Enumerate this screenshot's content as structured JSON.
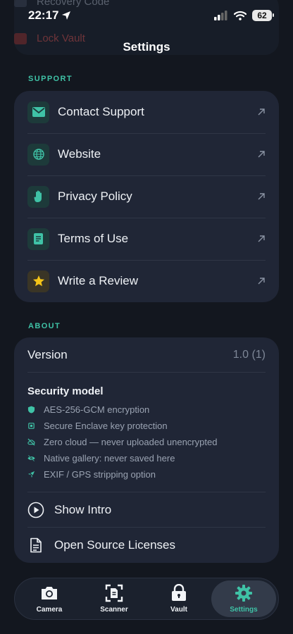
{
  "status_bar": {
    "time": "22:17",
    "battery": "62"
  },
  "background_rows": [
    {
      "label": "Recovery Code"
    },
    {
      "label": "Lock Vault"
    }
  ],
  "nav": {
    "title": "Settings"
  },
  "support": {
    "heading": "SUPPORT",
    "items": [
      {
        "label": "Contact Support",
        "icon": "envelope-icon"
      },
      {
        "label": "Website",
        "icon": "globe-icon"
      },
      {
        "label": "Privacy Policy",
        "icon": "hand-icon"
      },
      {
        "label": "Terms of Use",
        "icon": "document-icon"
      },
      {
        "label": "Write a Review",
        "icon": "star-icon"
      }
    ]
  },
  "about": {
    "heading": "ABOUT",
    "version_label": "Version",
    "version_value": "1.0 (1)",
    "security_title": "Security model",
    "security_items": [
      {
        "text": "AES-256-GCM encryption",
        "icon": "shield-icon"
      },
      {
        "text": "Secure Enclave key protection",
        "icon": "chip-icon"
      },
      {
        "text": "Zero cloud — never uploaded unencrypted",
        "icon": "cloud-off-icon"
      },
      {
        "text": "Native gallery: never saved here",
        "icon": "eye-off-icon"
      },
      {
        "text": "EXIF / GPS stripping option",
        "icon": "location-off-icon"
      }
    ],
    "show_intro": "Show Intro",
    "licenses": "Open Source Licenses"
  },
  "tabs": [
    {
      "label": "Camera",
      "icon": "camera-icon",
      "active": false
    },
    {
      "label": "Scanner",
      "icon": "scanner-icon",
      "active": false
    },
    {
      "label": "Vault",
      "icon": "vault-icon",
      "active": false
    },
    {
      "label": "Settings",
      "icon": "gear-icon",
      "active": true
    }
  ],
  "colors": {
    "accent": "#3fc2a6",
    "background": "#13171f",
    "card": "#202636"
  }
}
